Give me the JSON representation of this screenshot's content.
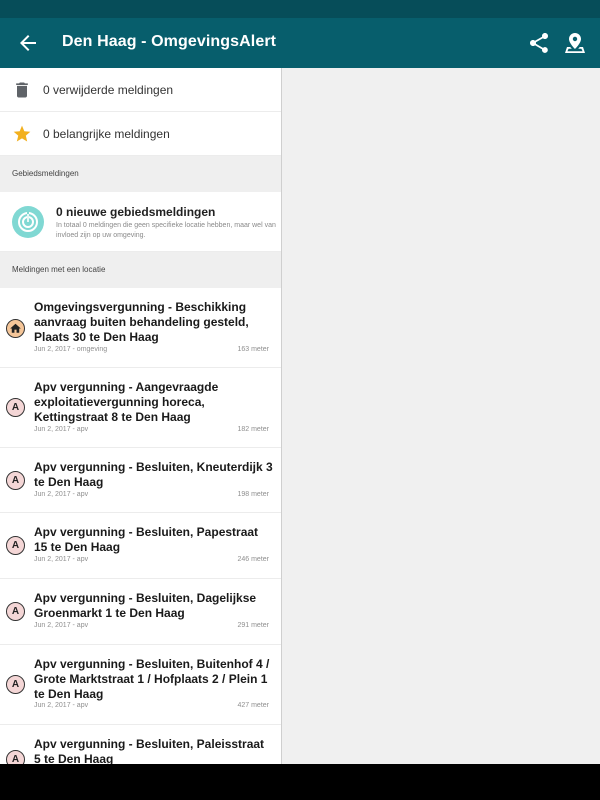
{
  "appbar": {
    "title": "Den Haag - OmgevingsAlert",
    "back_icon": "arrow-back-icon",
    "share_icon": "share-icon",
    "map_icon": "map-marker-icon"
  },
  "summary": {
    "deleted_label": "0 verwijderde meldingen",
    "important_label": "0 belangrijke meldingen"
  },
  "area_section": {
    "header": "Gebiedsmeldingen",
    "title": "0 nieuwe gebiedsmeldingen",
    "description": "In totaal 0 meldingen die geen specifieke locatie hebben, maar wel van invloed zijn op uw omgeving."
  },
  "location_section": {
    "header": "Meldingen met een locatie"
  },
  "items": [
    {
      "avatar": "home-icon",
      "title": "Omgevingsvergunning - Beschikking aanvraag buiten behandeling gesteld, Plaats 30 te Den Haag",
      "meta": "Jun 2, 2017 - omgeving",
      "distance": "163 meter"
    },
    {
      "avatar": "A",
      "title": "Apv vergunning - Aangevraagde exploitatievergunning horeca, Kettingstraat 8 te Den Haag",
      "meta": "Jun 2, 2017 - apv",
      "distance": "182 meter"
    },
    {
      "avatar": "A",
      "title": "Apv vergunning - Besluiten, Kneuterdijk 3 te Den Haag",
      "meta": "Jun 2, 2017 - apv",
      "distance": "198 meter"
    },
    {
      "avatar": "A",
      "title": "Apv vergunning - Besluiten, Papestraat 15 te Den Haag",
      "meta": "Jun 2, 2017 - apv",
      "distance": "246 meter"
    },
    {
      "avatar": "A",
      "title": "Apv vergunning - Besluiten, Dagelijkse Groenmarkt 1 te Den Haag",
      "meta": "Jun 2, 2017 - apv",
      "distance": "291 meter"
    },
    {
      "avatar": "A",
      "title": "Apv vergunning - Besluiten, Buitenhof 4 / Grote Marktstraat 1 / Hofplaats 2 / Plein 1 te Den Haag",
      "meta": "Jun 2, 2017 - apv",
      "distance": "427 meter"
    },
    {
      "avatar": "A",
      "title": "Apv vergunning - Besluiten, Paleisstraat 5 te Den Haag",
      "meta": "",
      "distance": ""
    }
  ],
  "colors": {
    "appbar": "#075e6c",
    "statusbar": "#064d59",
    "star": "#f2b01e",
    "area_circle": "#80d8d3"
  }
}
